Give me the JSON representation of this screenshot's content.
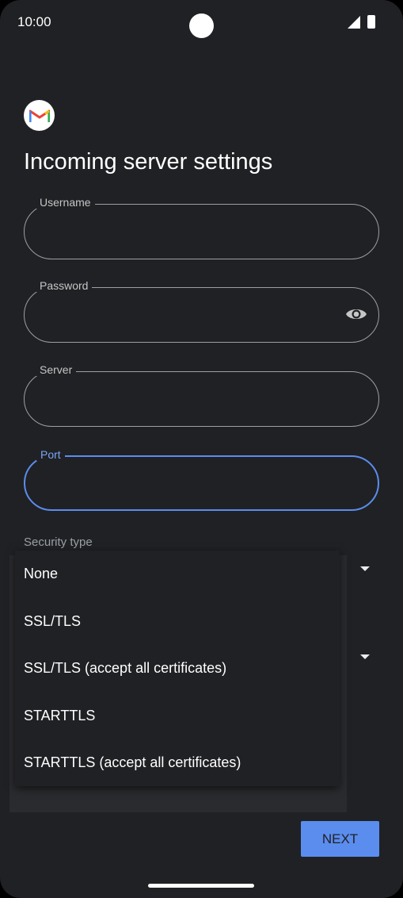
{
  "status_bar": {
    "time": "10:00"
  },
  "page": {
    "title": "Incoming server settings"
  },
  "fields": {
    "username": {
      "label": "Username",
      "value": ""
    },
    "password": {
      "label": "Password",
      "value": ""
    },
    "server": {
      "label": "Server",
      "value": ""
    },
    "port": {
      "label": "Port",
      "value": ""
    }
  },
  "security": {
    "label": "Security type",
    "options": [
      "None",
      "SSL/TLS",
      "SSL/TLS (accept all certificates)",
      "STARTTLS",
      "STARTTLS (accept all certificates)"
    ]
  },
  "actions": {
    "next_label": "NEXT"
  },
  "icons": {
    "app_logo": "gmail-logo-icon",
    "password_toggle": "eye-icon",
    "signal": "signal-icon",
    "battery": "battery-icon"
  },
  "colors": {
    "background": "#202124",
    "accent": "#5b8def"
  }
}
